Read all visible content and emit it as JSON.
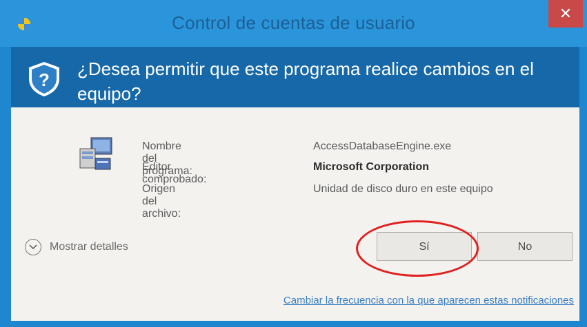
{
  "window": {
    "title": "Control de cuentas de usuario",
    "close_glyph": "✕",
    "title_icon": "uac-icon"
  },
  "header": {
    "question": "¿Desea permitir que este programa realice cambios en el equipo?",
    "icon": "shield-question-icon"
  },
  "details": {
    "program_icon": "program-installer-icon",
    "rows": [
      {
        "label": "Nombre del programa:",
        "value": "AccessDatabaseEngine.exe"
      },
      {
        "label": "Editor comprobado:",
        "value": "Microsoft Corporation"
      },
      {
        "label": "Origen del archivo:",
        "value": "Unidad de disco duro en este equipo"
      }
    ]
  },
  "footer": {
    "show_details": "Mostrar detalles",
    "yes_label": "Sí",
    "no_label": "No",
    "change_link": "Cambiar la frecuencia con la que aparecen estas notificaciones"
  },
  "colors": {
    "frame_blue": "#2b95dc",
    "header_blue": "#1768a9",
    "close_red": "#c94848",
    "annotation_red": "#e21f1f"
  }
}
